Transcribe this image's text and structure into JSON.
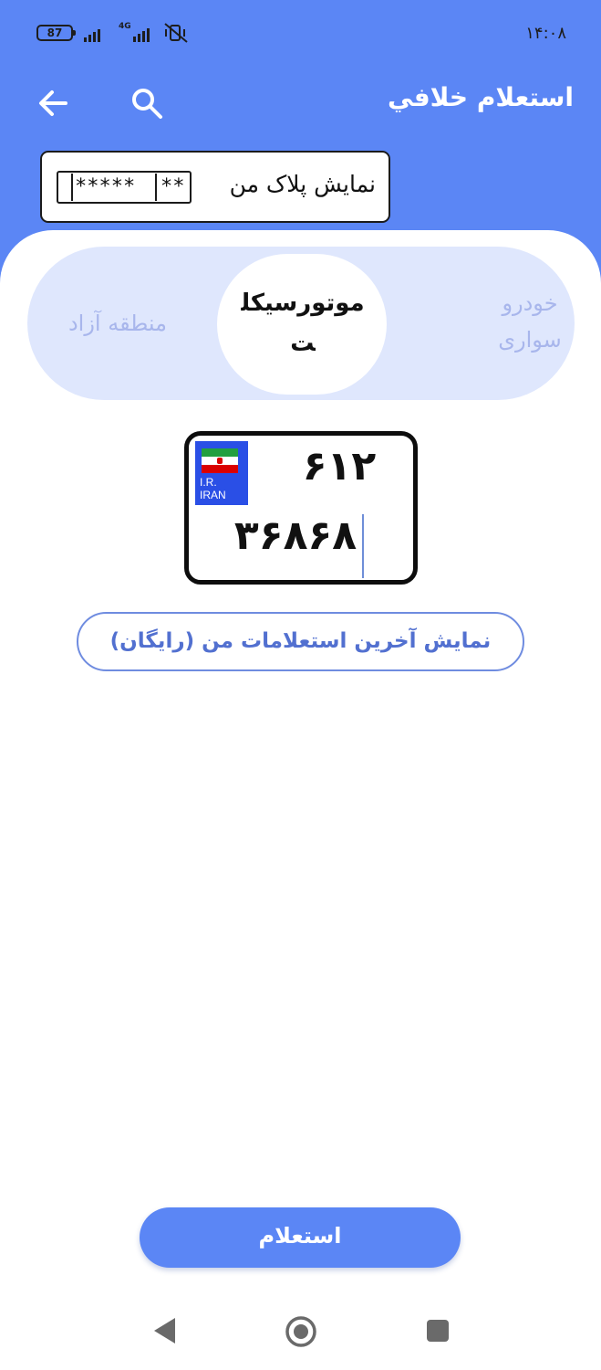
{
  "status_bar": {
    "battery": "87",
    "network": "4G",
    "time": "۱۴:۰۸"
  },
  "app_bar": {
    "title": "استعلام خلافي",
    "back_icon": "arrow-left-icon",
    "search_icon": "search-icon"
  },
  "my_plate": {
    "label": "نمایش پلاک من",
    "masked_left": "**",
    "masked_mid": "*****",
    "masked_right": ""
  },
  "vehicle_types": {
    "car": "خودرو سواری",
    "motorcycle": "موتورسیکلت",
    "free_zone": "منطقه آزاد",
    "selected": "motorcycle"
  },
  "plate": {
    "country_code": "I.R.",
    "country_name": "IRAN",
    "top_number": "۶۱۲",
    "bottom_number": "۳۶۸۶۸",
    "flag_colors": [
      "#239f40",
      "#ffffff",
      "#da0000"
    ]
  },
  "recent_button": {
    "label": "نمایش آخرین استعلامات من (رایگان)"
  },
  "submit_button": {
    "label": "استعلام"
  },
  "nav_bar": {
    "back": "nav-back-icon",
    "home": "nav-home-icon",
    "recents": "nav-recents-icon"
  },
  "colors": {
    "primary": "#5b86f5",
    "segment_bg": "#dfe7fd",
    "segment_inactive_text": "#a8b6ec",
    "plate_blue": "#2a4fe6"
  }
}
